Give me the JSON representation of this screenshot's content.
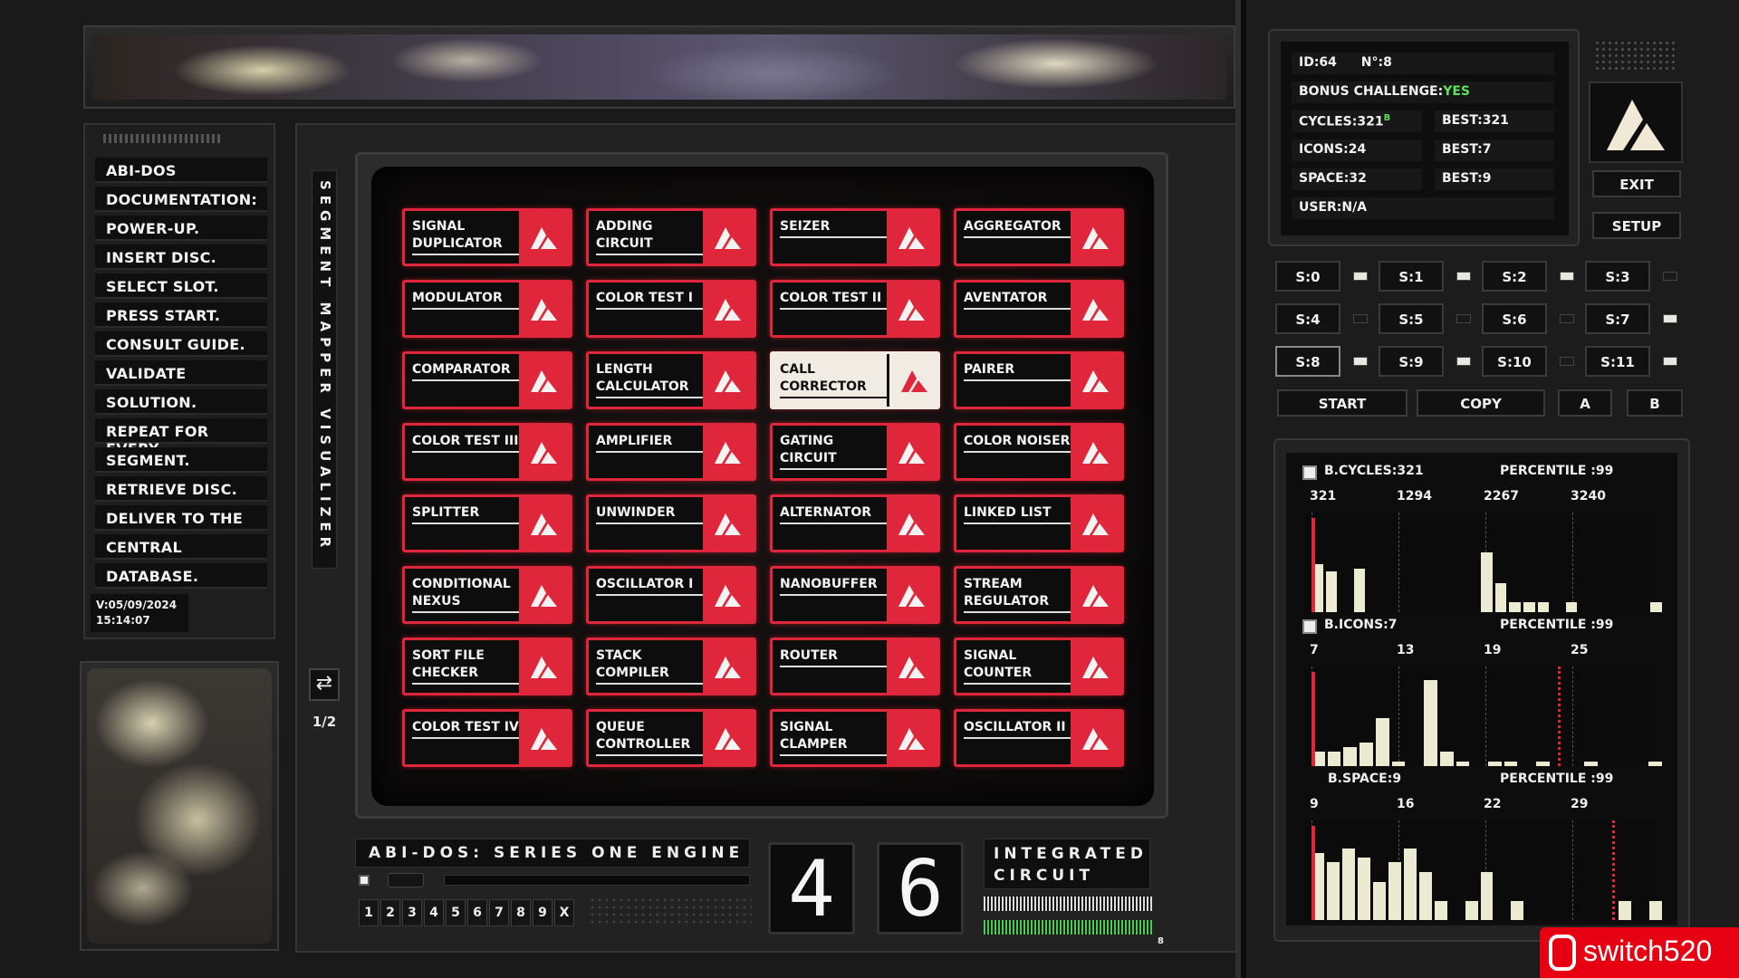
{
  "menu": {
    "items": [
      "ABI-DOS",
      "DOCUMENTATION:",
      "POWER-UP.",
      "INSERT DISC.",
      "SELECT SLOT.",
      "PRESS START.",
      "CONSULT GUIDE.",
      "VALIDATE",
      "SOLUTION.",
      "REPEAT FOR EVERY",
      "SEGMENT.",
      "RETRIEVE DISC.",
      "DELIVER TO THE",
      "CENTRAL",
      "DATABASE."
    ],
    "version": "V:05/09/2024",
    "time": "15:14:07"
  },
  "visualizer": {
    "vertical_title": "SEGMENT MAPPER VISUALIZER",
    "page": "1/2"
  },
  "tiles": [
    "SIGNAL DUPLICATOR",
    "ADDING CIRCUIT",
    "SEIZER",
    "AGGREGATOR",
    "MODULATOR",
    "COLOR TEST I",
    "COLOR TEST II",
    "AVENTATOR",
    "COMPARATOR",
    "LENGTH CALCULATOR",
    "CALL CORRECTOR",
    "PAIRER",
    "COLOR TEST III",
    "AMPLIFIER",
    "GATING CIRCUIT",
    "COLOR NOISER",
    "SPLITTER",
    "UNWINDER",
    "ALTERNATOR",
    "LINKED LIST",
    "CONDITIONAL NEXUS",
    "OSCILLATOR I",
    "NANOBUFFER",
    "STREAM REGULATOR",
    "SORT FILE CHECKER",
    "STACK COMPILER",
    "ROUTER",
    "SIGNAL COUNTER",
    "COLOR TEST IV",
    "QUEUE CONTROLLER",
    "SIGNAL CLAMPER",
    "OSCILLATOR II"
  ],
  "selected_tile": "CALL CORRECTOR",
  "footer": {
    "engine": "ABI-DOS: SERIES ONE ENGINE",
    "digit1": "4",
    "digit2": "6",
    "integrated": "INTEGRATED",
    "circuit": "CIRCUIT",
    "number_keys": [
      "1",
      "2",
      "3",
      "4",
      "5",
      "6",
      "7",
      "8",
      "9",
      "X"
    ],
    "meter_end_label": "8"
  },
  "info": {
    "id": "ID:64",
    "no": "N°:8",
    "bonus_label": "BONUS CHALLENGE:",
    "bonus_value": "YES",
    "cycles": "CYCLES:321",
    "cycles_suffix": "B",
    "best_cycles": "BEST:321",
    "icons": "ICONS:24",
    "best_icons": "BEST:7",
    "space": "SPACE:32",
    "best_space": "BEST:9",
    "user": "USER:N/A"
  },
  "buttons": {
    "exit": "EXIT",
    "setup": "SETUP",
    "start": "START",
    "copy": "COPY",
    "a": "A",
    "b": "B"
  },
  "slots": [
    "S:0",
    "S:1",
    "S:2",
    "S:3",
    "S:4",
    "S:5",
    "S:6",
    "S:7",
    "S:8",
    "S:9",
    "S:10",
    "S:11"
  ],
  "slot_leds_on": [
    true,
    true,
    true,
    false,
    false,
    false,
    false,
    true,
    true,
    true,
    false,
    true
  ],
  "charts": {
    "cycles": {
      "title": "B.CYCLES:321",
      "percentile": "PERCENTILE :99",
      "ticks": [
        "321",
        "1294",
        "2267",
        "3240"
      ]
    },
    "icons": {
      "title": "B.ICONS:7",
      "percentile": "PERCENTILE :99",
      "ticks": [
        "7",
        "13",
        "19",
        "25"
      ]
    },
    "space": {
      "title": "B.SPACE:9",
      "percentile": "PERCENTILE :99",
      "ticks": [
        "9",
        "16",
        "22",
        "29"
      ]
    }
  },
  "chart_data": [
    {
      "type": "bar",
      "title": "B.CYCLES:321",
      "values": [
        0.5,
        0.42,
        0,
        0.45,
        0,
        0,
        0,
        0,
        0,
        0,
        0,
        0,
        0.62,
        0.3,
        0.1,
        0.1,
        0.1,
        0,
        0.1,
        0,
        0,
        0,
        0,
        0,
        0.1
      ],
      "marker_value": 321
    },
    {
      "type": "bar",
      "title": "B.ICONS:7",
      "values": [
        0.15,
        0.15,
        0.2,
        0.25,
        0.5,
        0.05,
        0,
        0.9,
        0.15,
        0.05,
        0,
        0.05,
        0.05,
        0,
        0.05,
        0,
        0,
        0.05,
        0,
        0,
        0,
        0.05
      ],
      "marker_value": 7
    },
    {
      "type": "bar",
      "title": "B.SPACE:9",
      "values": [
        0.7,
        0.6,
        0.75,
        0.65,
        0.4,
        0.6,
        0.75,
        0.5,
        0.2,
        0,
        0.2,
        0.5,
        0,
        0.2,
        0,
        0,
        0,
        0,
        0,
        0,
        0.2,
        0,
        0.2
      ],
      "marker_value": 9
    }
  ],
  "watermark": "switch520"
}
